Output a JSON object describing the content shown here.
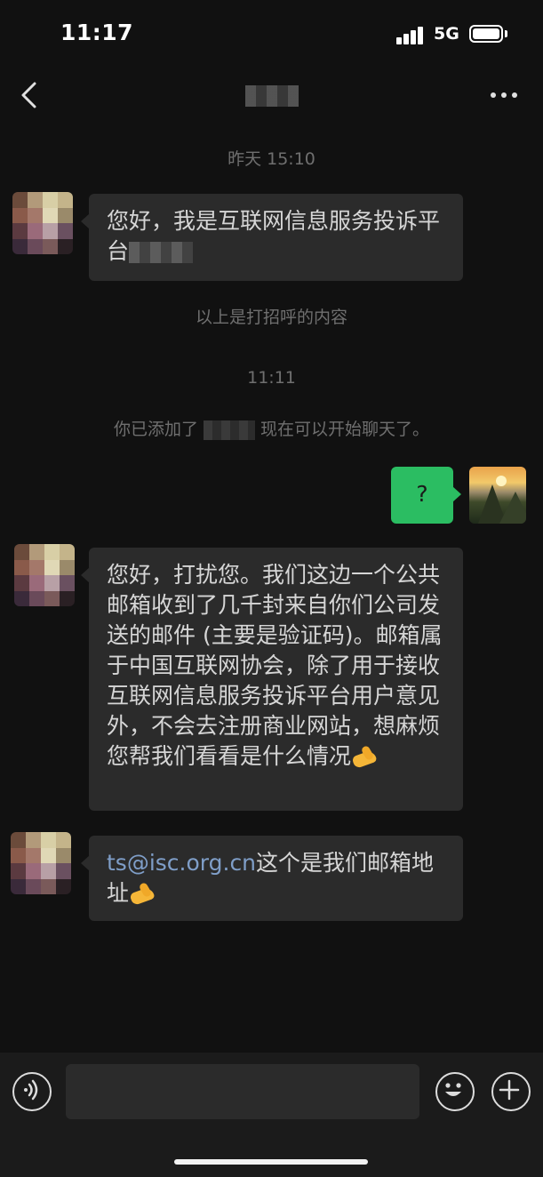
{
  "status_bar": {
    "time": "11:17",
    "network": "5G"
  },
  "nav": {
    "back_icon": "chevron-left-icon",
    "more_icon": "more-dots-icon"
  },
  "messages": {
    "ts1": "昨天 15:10",
    "greeting_1": "您好，我是互联网信息服务投诉平台",
    "greeting_note": "以上是打招呼的内容",
    "ts2": "11:11",
    "added_prefix": "你已添加了",
    "added_suffix": "现在可以开始聊天了。",
    "me_question": "?",
    "msg_2": "您好，打扰您。我们这边一个公共邮箱收到了几千封来自你们公司发送的邮件 (主要是验证码)。邮箱属于中国互联网协会，除了用于接收互联网信息服务投诉平台用户意见外，不会去注册商业网站，想麻烦您帮我们看看是什么情况",
    "msg_3_email": "ts@isc.org.cn",
    "msg_3_text": "这个是我们邮箱地址"
  },
  "input_bar": {
    "voice_icon": "voice-icon",
    "emoji_icon": "emoji-icon",
    "plus_icon": "plus-icon"
  },
  "colors": {
    "background": "#111111",
    "bubble": "#2b2b2b",
    "my_bubble": "#2bbd62",
    "link": "#7f9ec8"
  }
}
